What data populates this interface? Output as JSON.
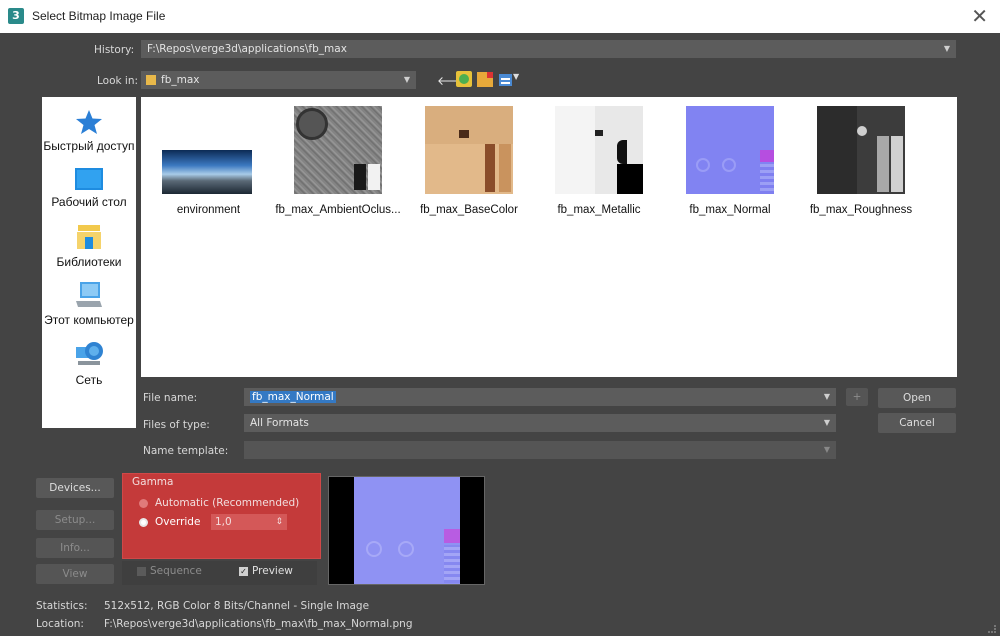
{
  "window": {
    "title": "Select Bitmap Image File",
    "close_glyph": "✕",
    "app_icon": "3"
  },
  "history": {
    "label": "History:",
    "value": "F:\\Repos\\verge3d\\applications\\fb_max"
  },
  "lookin": {
    "label": "Look in:",
    "value": "fb_max"
  },
  "places": [
    {
      "label": "Быстрый доступ",
      "icon": "star-icon"
    },
    {
      "label": "Рабочий стол",
      "icon": "desktop-icon"
    },
    {
      "label": "Библиотеки",
      "icon": "libraries-icon"
    },
    {
      "label": "Этот компьютер",
      "icon": "computer-icon"
    },
    {
      "label": "Сеть",
      "icon": "network-icon"
    }
  ],
  "files": [
    {
      "name": "environment"
    },
    {
      "name": "fb_max_AmbientOclus..."
    },
    {
      "name": "fb_max_BaseColor"
    },
    {
      "name": "fb_max_Metallic"
    },
    {
      "name": "fb_max_Normal"
    },
    {
      "name": "fb_max_Roughness"
    }
  ],
  "file_name": {
    "label": "File name:",
    "value": "fb_max_Normal"
  },
  "files_of_type": {
    "label": "Files of type:",
    "value": "All Formats"
  },
  "name_template": {
    "label": "Name template:",
    "value": ""
  },
  "buttons": {
    "open": "Open",
    "cancel": "Cancel",
    "plus": "+",
    "devices": "Devices...",
    "setup": "Setup...",
    "info": "Info...",
    "view": "View"
  },
  "gamma": {
    "title": "Gamma",
    "automatic": "Automatic (Recommended)",
    "override": "Override",
    "override_value": "1,0"
  },
  "sequence": {
    "label": "Sequence",
    "checked": false
  },
  "preview": {
    "label": "Preview",
    "checked": true
  },
  "statistics": {
    "label": "Statistics:",
    "value": "512x512, RGB Color 8 Bits/Channel - Single Image"
  },
  "location": {
    "label": "Location:",
    "value": "F:\\Repos\\verge3d\\applications\\fb_max\\fb_max_Normal.png"
  },
  "colors": {
    "accent": "#c43a3a",
    "selection": "#3479c4",
    "panel": "#444444",
    "field": "#5c5c5c"
  }
}
